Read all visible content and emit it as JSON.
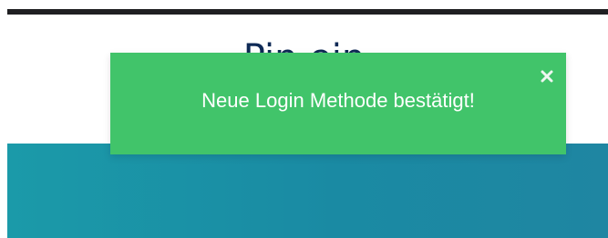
{
  "header": {
    "title": "Pin ein"
  },
  "toast": {
    "message": "Neue Login Methode bestätigt!",
    "close_icon": "close-icon",
    "background_color": "#41c46a",
    "text_color": "#ffffff"
  },
  "hero": {
    "background_color": "#1a8ea5"
  },
  "top_bar": {
    "color": "#1f1f22"
  }
}
